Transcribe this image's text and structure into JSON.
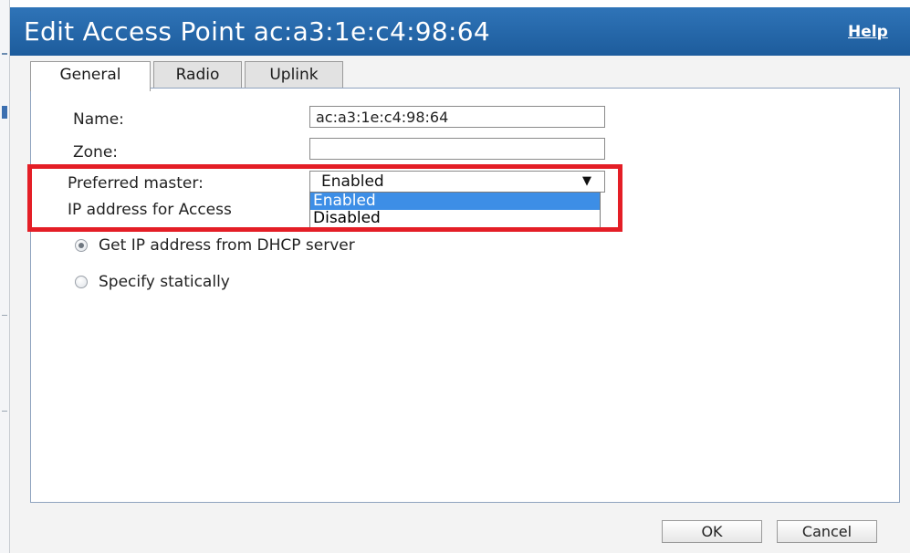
{
  "dialog": {
    "title": "Edit Access Point ac:a3:1e:c4:98:64",
    "help_label": "Help"
  },
  "tabs": [
    {
      "label": "General",
      "active": true
    },
    {
      "label": "Radio",
      "active": false
    },
    {
      "label": "Uplink",
      "active": false
    }
  ],
  "form": {
    "name_label": "Name:",
    "name_value": "ac:a3:1e:c4:98:64",
    "zone_label": "Zone:",
    "zone_value": "",
    "preferred_master_label": "Preferred master:",
    "preferred_master_value": "Enabled",
    "preferred_master_options": [
      "Enabled",
      "Disabled"
    ],
    "ip_section_label": "IP address for Access",
    "ip_options": [
      {
        "label": "Get IP address from DHCP server",
        "selected": true
      },
      {
        "label": "Specify statically",
        "selected": false
      }
    ]
  },
  "buttons": {
    "ok_label": "OK",
    "cancel_label": "Cancel"
  },
  "colors": {
    "titlebar": "#2f74b8",
    "highlight_box": "#e41e26",
    "selected_option": "#3d8ee6"
  }
}
